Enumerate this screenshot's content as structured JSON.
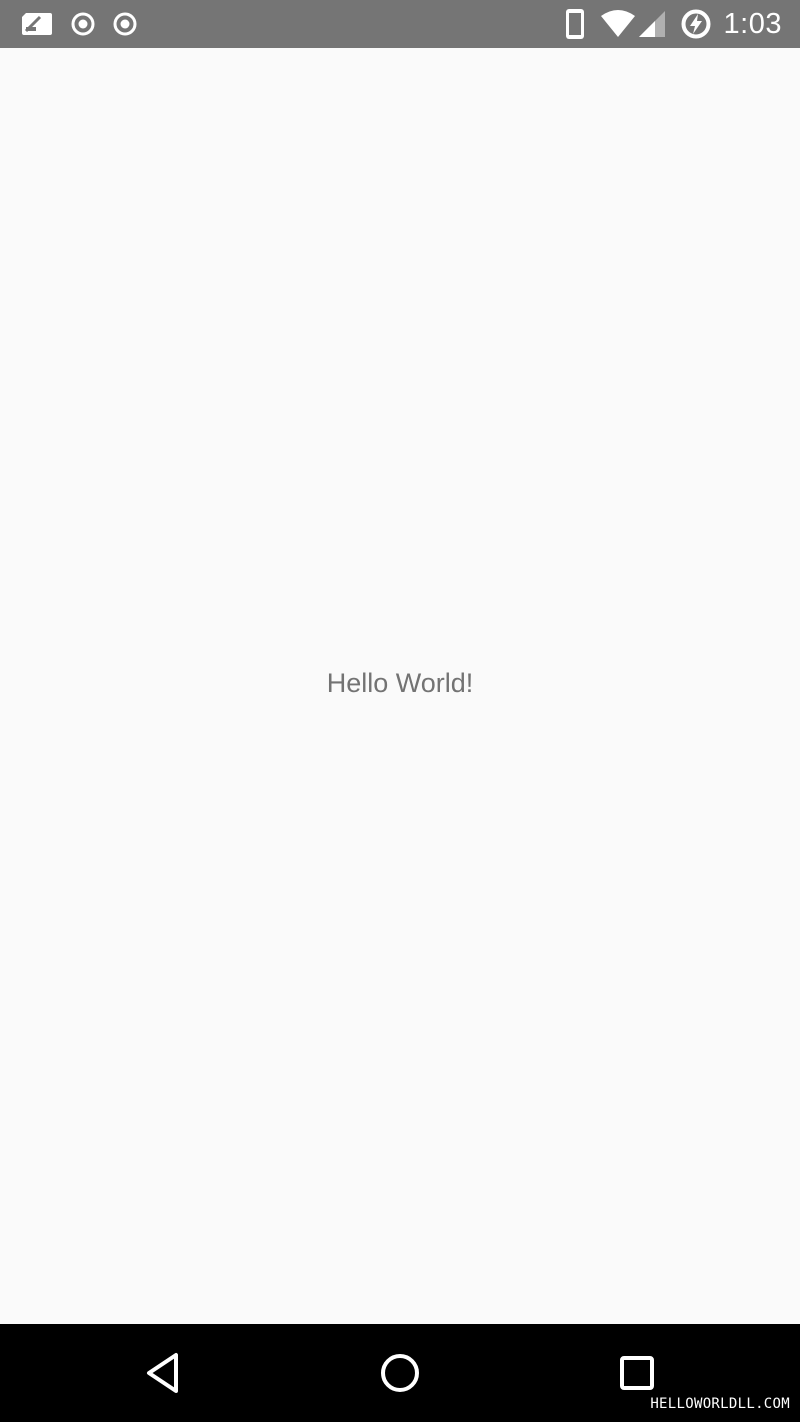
{
  "status_bar": {
    "left_icons": [
      "no-sim-icon",
      "location-target-icon",
      "location-target-icon"
    ],
    "right_icons": [
      "phone-vibrate-icon",
      "wifi-icon",
      "cellular-signal-icon",
      "battery-charging-icon"
    ],
    "time": "1:03",
    "background_color": "#757575"
  },
  "main": {
    "text": "Hello World!",
    "text_color": "#737373",
    "background_color": "#fafafa"
  },
  "nav_bar": {
    "buttons": [
      "back-icon",
      "home-icon",
      "recents-icon"
    ],
    "background_color": "#000000"
  },
  "watermark": "HELLOWORLDLL.COM"
}
